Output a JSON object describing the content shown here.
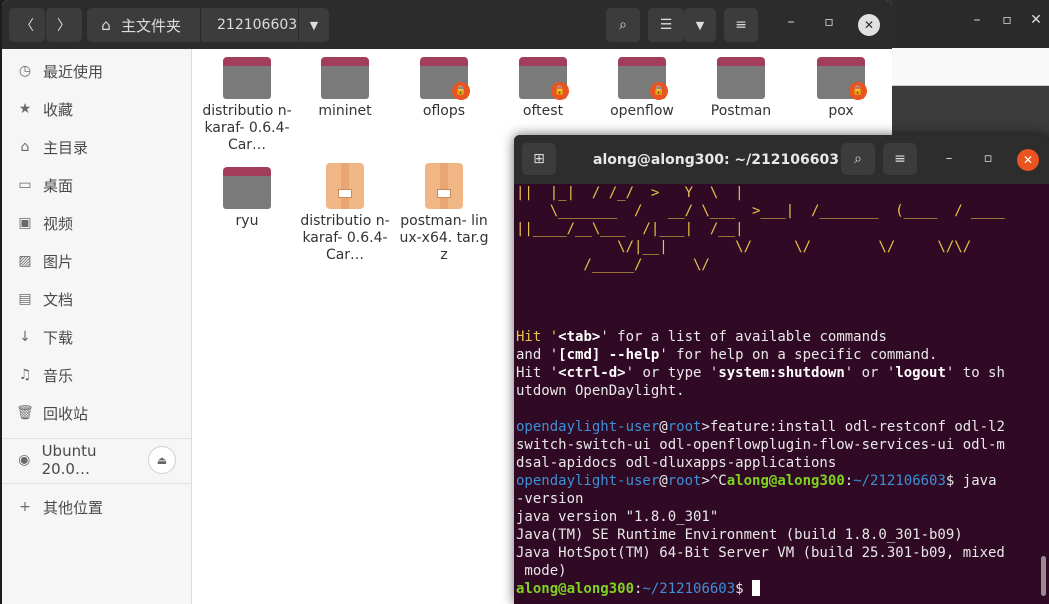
{
  "file_manager": {
    "path_home": "主文件夹",
    "path_current": "212106603",
    "sidebar": [
      {
        "label": "最近使用",
        "icon": "clock-icon"
      },
      {
        "label": "收藏",
        "icon": "star-icon"
      },
      {
        "label": "主目录",
        "icon": "home-icon"
      },
      {
        "label": "桌面",
        "icon": "desktop-icon"
      },
      {
        "label": "视频",
        "icon": "video-icon"
      },
      {
        "label": "图片",
        "icon": "picture-icon"
      },
      {
        "label": "文档",
        "icon": "document-icon"
      },
      {
        "label": "下载",
        "icon": "download-icon"
      },
      {
        "label": "音乐",
        "icon": "music-icon"
      },
      {
        "label": "回收站",
        "icon": "trash-icon"
      }
    ],
    "drive": "Ubuntu 20.0…",
    "other_locations": "其他位置",
    "files": [
      {
        "name": "distributio n-karaf- 0.6.4-Car…",
        "kind": "folder",
        "locked": false
      },
      {
        "name": "mininet",
        "kind": "folder",
        "locked": false
      },
      {
        "name": "oflops",
        "kind": "folder",
        "locked": true
      },
      {
        "name": "oftest",
        "kind": "folder",
        "locked": true
      },
      {
        "name": "openflow",
        "kind": "folder",
        "locked": true
      },
      {
        "name": "Postman",
        "kind": "folder",
        "locked": false
      },
      {
        "name": "pox",
        "kind": "folder",
        "locked": true
      },
      {
        "name": "ryu",
        "kind": "folder",
        "locked": false
      },
      {
        "name": "distributio n-karaf- 0.6.4-Car…",
        "kind": "archive",
        "locked": false
      },
      {
        "name": "postman- linux-x64. tar.gz",
        "kind": "archive",
        "locked": false
      }
    ]
  },
  "terminal": {
    "title": "along@along300: ~/212106603",
    "ascii": [
      "||  |_|  / /_/  >   Y  \\  |",
      "    \\_______  /   __/ \\___  >___|  /_______  (____  / ____",
      "||____/__\\___  /|___|  /__|",
      "            \\/|__|        \\/     \\/        \\/     \\/\\/",
      "        /_____/      \\/"
    ],
    "hint1": {
      "a": "Hit '",
      "b": "<tab>",
      "c": "' for a list of available commands"
    },
    "hint2": {
      "a": "and '",
      "b": "[cmd] --help",
      "c": "' for help on a specific command."
    },
    "hint3": {
      "a": "Hit '",
      "b": "<ctrl-d>",
      "c": "' or type '",
      "d": "system:shutdown",
      "e": "' or '",
      "f": "logout",
      "g": "' to sh"
    },
    "hint4": "utdown OpenDaylight.",
    "odl_user": "opendaylight-user",
    "at": "@",
    "odl_host": "root",
    "cmd1": ">feature:install odl-restconf odl-l2",
    "cmd1b": "switch-switch-ui odl-openflowplugin-flow-services-ui odl-m",
    "cmd1c": "dsal-apidocs odl-dluxapps-applications",
    "interrupt": ">^C",
    "shell_user": "along@along300",
    "colon": ":",
    "shell_path": "~/212106603",
    "cmd2": "$ java",
    "cmd2b": "-version",
    "out1": "java version \"1.8.0_301\"",
    "out2": "Java(TM) SE Runtime Environment (build 1.8.0_301-b09)",
    "out3": "Java HotSpot(TM) 64-Bit Server VM (build 25.301-b09, mixed",
    "out4": " mode)",
    "prompt_end": "$ "
  }
}
